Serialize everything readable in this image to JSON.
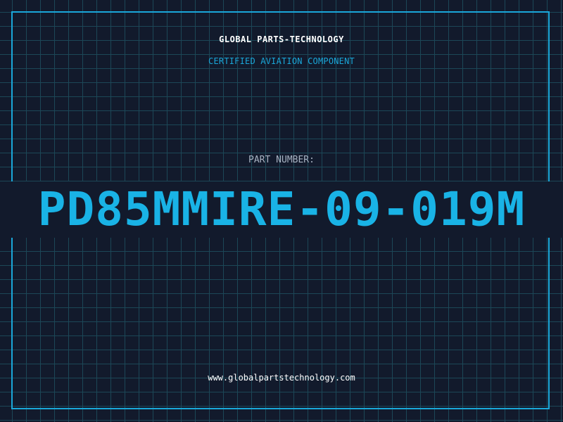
{
  "header": {
    "company": "GLOBAL PARTS-TECHNOLOGY",
    "subtitle": "CERTIFIED AVIATION COMPONENT"
  },
  "part": {
    "label": "PART NUMBER:",
    "number": "PD85MMIRE-09-019M"
  },
  "footer": {
    "url": "www.globalpartstechnology.com"
  },
  "colors": {
    "background": "#121a2c",
    "grid": "#1c4757",
    "accent": "#1aa7d9",
    "text": "#ffffff",
    "muted": "#a7b2c2"
  }
}
